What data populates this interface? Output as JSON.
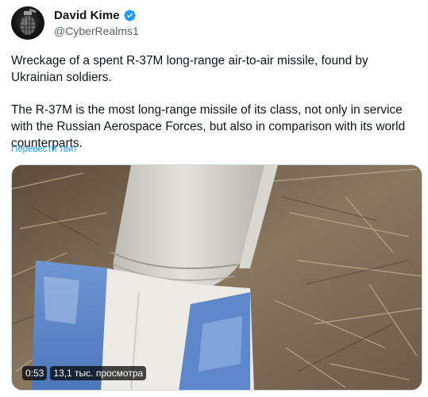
{
  "author": {
    "display_name": "David Kime",
    "handle": "@CyberRealms1"
  },
  "tweet": {
    "paragraphs": [
      "Wreckage of a spent R-37M long-range air-to-air missile, found by Ukrainian soldiers.",
      "The R-37M is the most long-range missile of its class, not only in service with the Russian Aerospace Forces, but also in comparison with its world counterparts."
    ],
    "translate_link": "Перевести твит"
  },
  "video": {
    "duration": "0:53",
    "views": "13,1 тыс. просмотра"
  },
  "colors": {
    "link": "#1d9bf0",
    "verified": "#1d9bf0",
    "text": "#0f1419",
    "secondary_text": "#536471"
  },
  "icons": {
    "verified": "verified-badge-icon",
    "avatar": "grenade-avatar"
  }
}
